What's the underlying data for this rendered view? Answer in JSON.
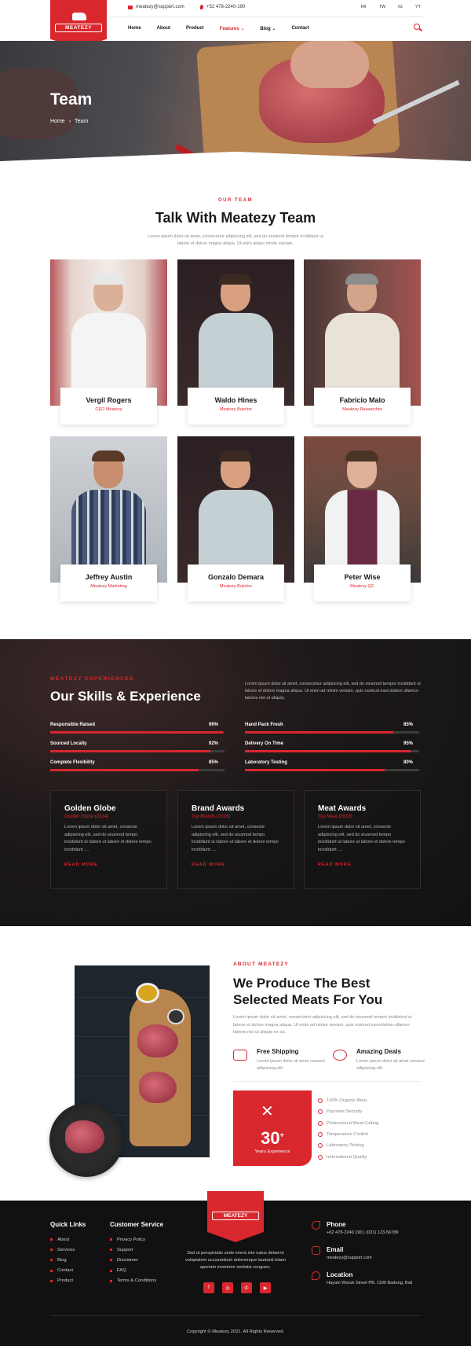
{
  "topbar": {
    "email": "meatezy@support.com",
    "phone": "+52 478-2240-190",
    "social": [
      "FB",
      "TW",
      "IG",
      "YT"
    ]
  },
  "logo": {
    "text": "MEATEZY"
  },
  "nav": {
    "items": [
      "Home",
      "About",
      "Product",
      "Features",
      "Blog",
      "Contact"
    ],
    "active": "Features"
  },
  "hero": {
    "title": "Team",
    "crumb_home": "Home",
    "crumb_current": "Team"
  },
  "team": {
    "eyebrow": "OUR TEAM",
    "title": "Talk With Meatezy Team",
    "text": "Lorem ipsum dolor sit amet, consectetur adipiscing elit, sed do eiusmod tempor incididunt ut labore et dolore magna aliqua. Ut enim aliqua minim veniam.",
    "members": [
      {
        "name": "Vergil Rogers",
        "role": "CEO Meatezy"
      },
      {
        "name": "Waldo Hines",
        "role": "Meatezy Butcher"
      },
      {
        "name": "Fabricio Malo",
        "role": "Meatezy Researcher"
      },
      {
        "name": "Jeffrey Austin",
        "role": "Meatezy Marketing"
      },
      {
        "name": "Gonzalo Demara",
        "role": "Meatezy Butcher"
      },
      {
        "name": "Peter Wise",
        "role": "Meatezy QC"
      }
    ]
  },
  "skills": {
    "eyebrow": "MEATEZY EXPERIENCES",
    "title": "Our Skills & Experience",
    "text": "Lorem ipsum dolor sit amet, consectetur adipiscing elit, sed do eiusmod tempor incididunt ut labore et dolore magna aliqua. Ut enim ad minim veniam, quis nostrud exercitation ullamco laboris nisi ut aliquip.",
    "bars": [
      {
        "label": "Responsible Raised",
        "value": 99
      },
      {
        "label": "Sourced Locally",
        "value": 92
      },
      {
        "label": "Complete Flexibility",
        "value": 85
      },
      {
        "label": "Hand Pack Fresh",
        "value": 85
      },
      {
        "label": "Delivery On Time",
        "value": 95
      },
      {
        "label": "Laboratory Testing",
        "value": 80
      }
    ],
    "awards": [
      {
        "title": "Golden Globe",
        "sub": "Golden Globe (2014)",
        "text": "Lorem ipsum dolor sit amet, consecte adipiscing elit, sed do eiusmod tempo incididunt ut labore ut labore et dolore tempo incididunt ....",
        "link": "READ MORE"
      },
      {
        "title": "Brand Awards",
        "sub": "Top Brands (2016)",
        "text": "Lorem ipsum dolor sit amet, consecte adipiscing elit, sed do eiusmod tempo incididunt ut labore ut labore et dolore tempo incididunt ....",
        "link": "READ MORE"
      },
      {
        "title": "Meat Awards",
        "sub": "Top Meat (2019)",
        "text": "Lorem ipsum dolor sit amet, consecte adipiscing elit, sed do eiusmod tempo incididunt ut labore ut labore et dolore tempo incididunt ....",
        "link": "READ MORE"
      }
    ]
  },
  "about": {
    "eyebrow": "ABOUT MEATEZY",
    "title_line1": "We Produce The Best",
    "title_line2": "Selected Meats For You",
    "text": "Lorem ipsum dolor sit amet, consectetur adipiscing elit, sed do eiusmod tempor incididunt ut labore et dolore magna aliqua. Ut enim ad minim veniam, quis nostrud exercitation ullamco laboris nisi ut aliquip ex ea.",
    "features": [
      {
        "title": "Free Shipping",
        "text": "Lorem ipsum dolor sit amet consect adipiscing elit."
      },
      {
        "title": "Amazing Deals",
        "text": "Lorem ipsum dolor sit amet consect adipiscing elit."
      }
    ],
    "experience_number": "30",
    "experience_plus": "+",
    "experience_label": "Years Experience",
    "checklist": [
      "100% Organic Meat",
      "Payment Security",
      "Professional Meat Cutting",
      "Temperature Control",
      "Laboratory Testing",
      "International Quality"
    ]
  },
  "footer": {
    "quick_links_title": "Quick Links",
    "quick_links": [
      "About",
      "Services",
      "Blog",
      "Contact",
      "Product"
    ],
    "customer_service_title": "Customer Service",
    "customer_service": [
      "Privacy Policy",
      "Support",
      "Disclaimer",
      "FAQ",
      "Terms & Conditions"
    ],
    "logo_text": "MEATEZY",
    "description": "Sed ut perspiciatis unde omnis iste natus delaerot voluptatem accusantium doloremque laudanti totam aperiam inventore veritatis congueu.",
    "social": [
      "f",
      "◎",
      "✆",
      "▶"
    ],
    "phone_title": "Phone",
    "phone_value": "+62 478-2240 190 | (021) 123-56789",
    "email_title": "Email",
    "email_value": "meatezy@support.com",
    "location_title": "Location",
    "location_value": "Hayam Wuruk Street PB. 1190 Badung, Bali",
    "copyright": "Copyright © Meatezy 2021. All Rights Reserved."
  }
}
